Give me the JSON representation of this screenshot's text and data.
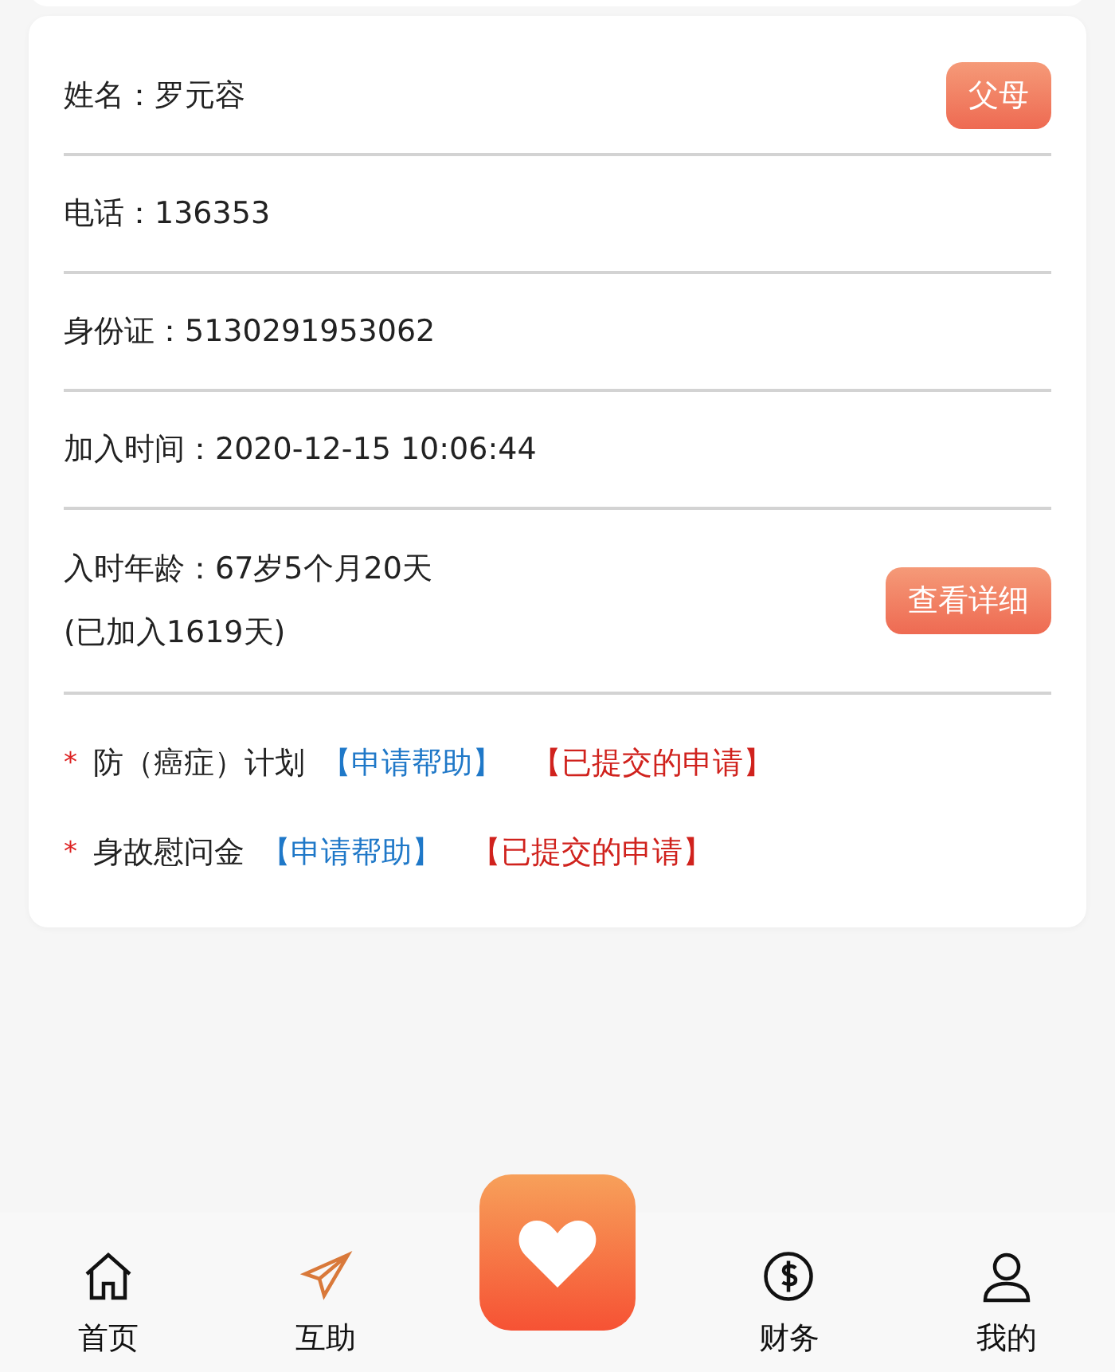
{
  "profile": {
    "rows": [
      {
        "label": "姓名：",
        "value": "罗元容",
        "button": "父母"
      },
      {
        "label": "电话：",
        "value": "136353"
      },
      {
        "label": "身份证：",
        "value": "5130291953062"
      },
      {
        "label": "加入时间：",
        "value": "2020-12-15 10:06:44"
      },
      {
        "label": "入时年龄：",
        "value": "67岁5个月20天",
        "note": "(已加入1619天)",
        "button": "查看详细"
      }
    ],
    "benefits": [
      {
        "mark": "*",
        "name": "防（癌症）计划",
        "apply": "【申请帮助】",
        "submitted": "【已提交的申请】"
      },
      {
        "mark": "*",
        "name": "身故慰问金",
        "apply": "【申请帮助】",
        "submitted": "【已提交的申请】"
      }
    ]
  },
  "nav": [
    {
      "kind": "home",
      "label": "首页",
      "selected": false
    },
    {
      "kind": "help",
      "label": "互助",
      "selected": true
    },
    {
      "kind": "center"
    },
    {
      "kind": "finance",
      "label": "财务",
      "selected": false
    },
    {
      "kind": "me",
      "label": "我的",
      "selected": false
    }
  ]
}
